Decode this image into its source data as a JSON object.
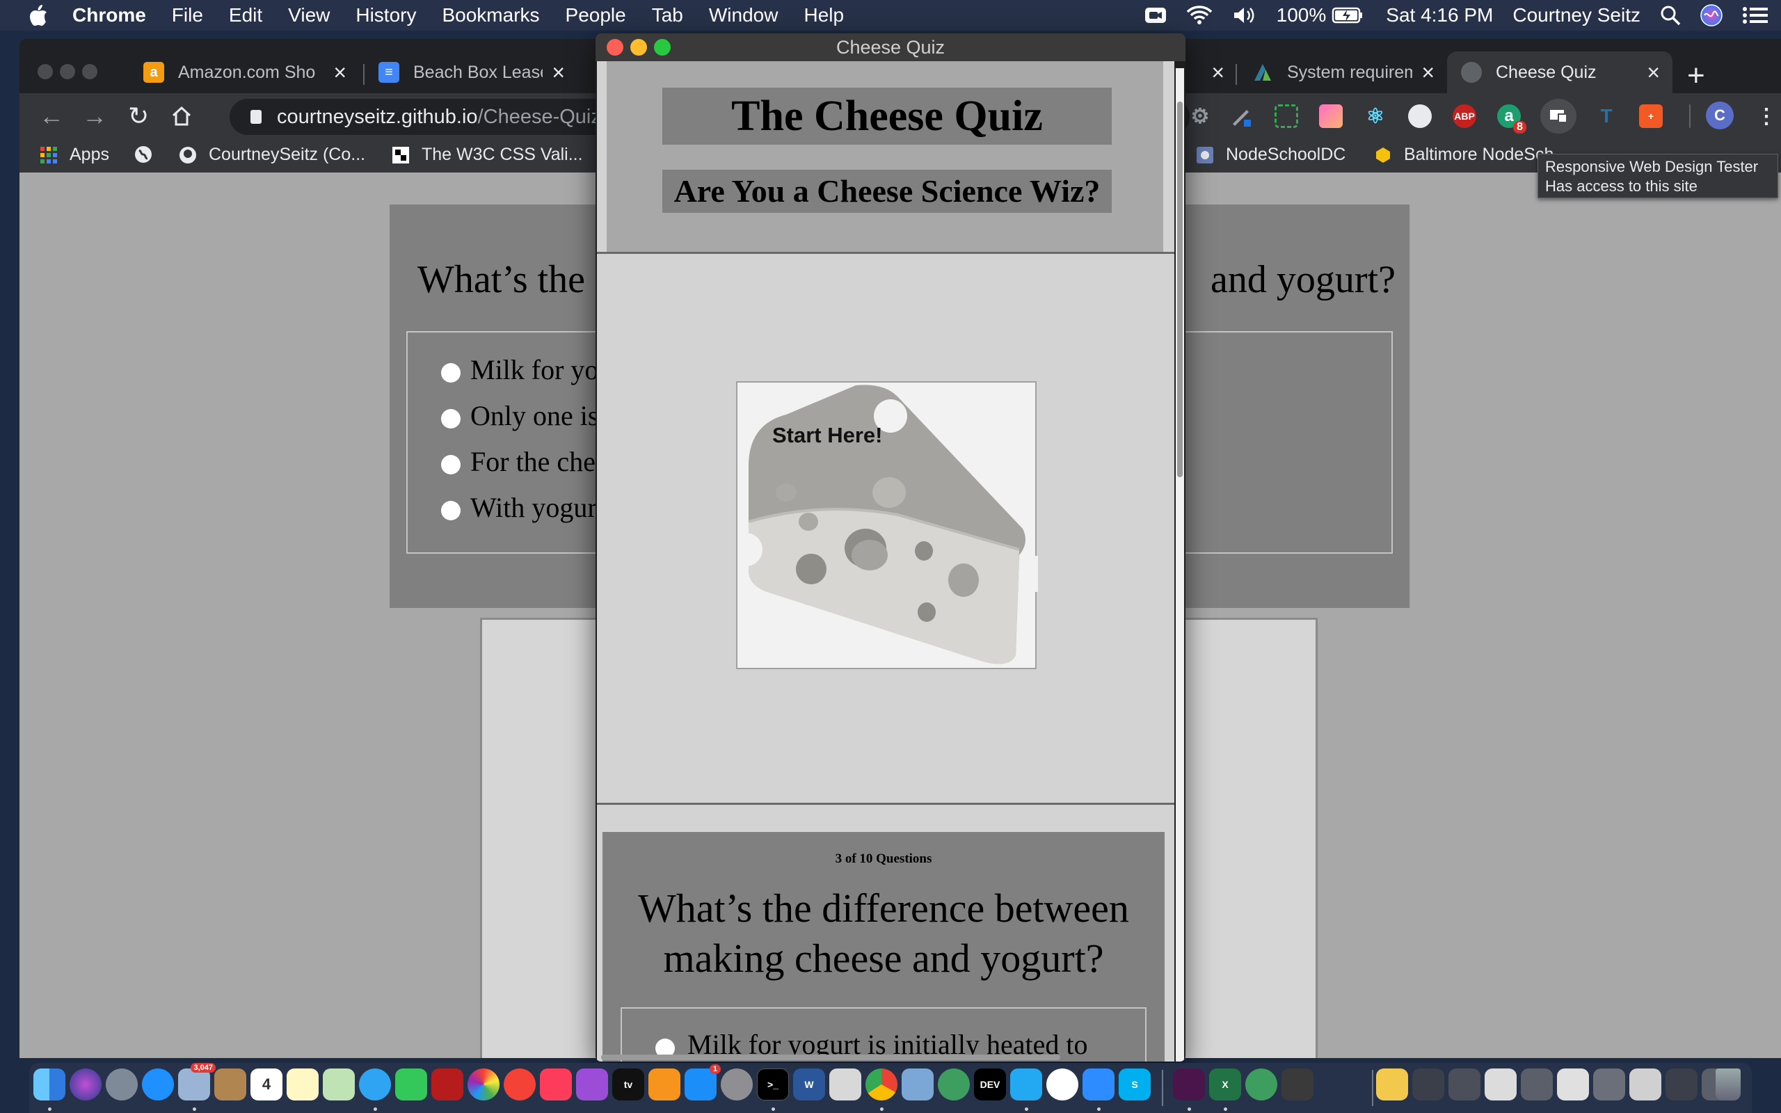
{
  "menubar": {
    "app": "Chrome",
    "items": [
      "File",
      "Edit",
      "View",
      "History",
      "Bookmarks",
      "People",
      "Tab",
      "Window",
      "Help"
    ],
    "battery": "100%",
    "clock": "Sat 4:16 PM",
    "user": "Courtney Seitz"
  },
  "tabs": {
    "t1": "Amazon.com Sho",
    "t2": "Beach Box Lease",
    "t4": "System requirem",
    "t5": "Cheese Quiz"
  },
  "omnibox": {
    "host": "courtneyseitz.github.io",
    "path": "/Cheese-Quiz/"
  },
  "extensions": {
    "abp": "ABP",
    "badge": "8",
    "profile": "C"
  },
  "bookmarks": {
    "apps": "Apps",
    "b1": "CourtneySeitz (Co...",
    "b2": "The W3C CSS Vali...",
    "b3": "NodeSchoolDC",
    "b4": "Baltimore NodeSch"
  },
  "tooltip": {
    "line1": "Responsive Web Design Tester",
    "line2": "Has access to this site"
  },
  "background_page": {
    "question_left": "What’s the",
    "question_right": "and yogurt?",
    "options": [
      "Milk for yo",
      "Only one is",
      "For the che",
      "With yogur"
    ]
  },
  "popup": {
    "title": "Cheese Quiz",
    "heading": "The Cheese Quiz",
    "subheading": "Are You a Cheese Science Wiz?",
    "start_label": "Start Here!",
    "progress": "3 of 10 Questions",
    "question": "What’s the difference between making cheese and yogurt?",
    "option1": "Milk for yogurt is initially heated to"
  },
  "dock": {
    "mail_badge": "3,047",
    "calendar_day": "4",
    "appstore_badge": "1",
    "dev_label": "DEV"
  },
  "colors": {
    "menubar": "#27324a",
    "chrome_frame": "#202124",
    "toolbar": "#35363a",
    "page_bg": "#a8a8a8",
    "quiz_card": "#808080",
    "quiz_panel": "#d3d3d3"
  }
}
